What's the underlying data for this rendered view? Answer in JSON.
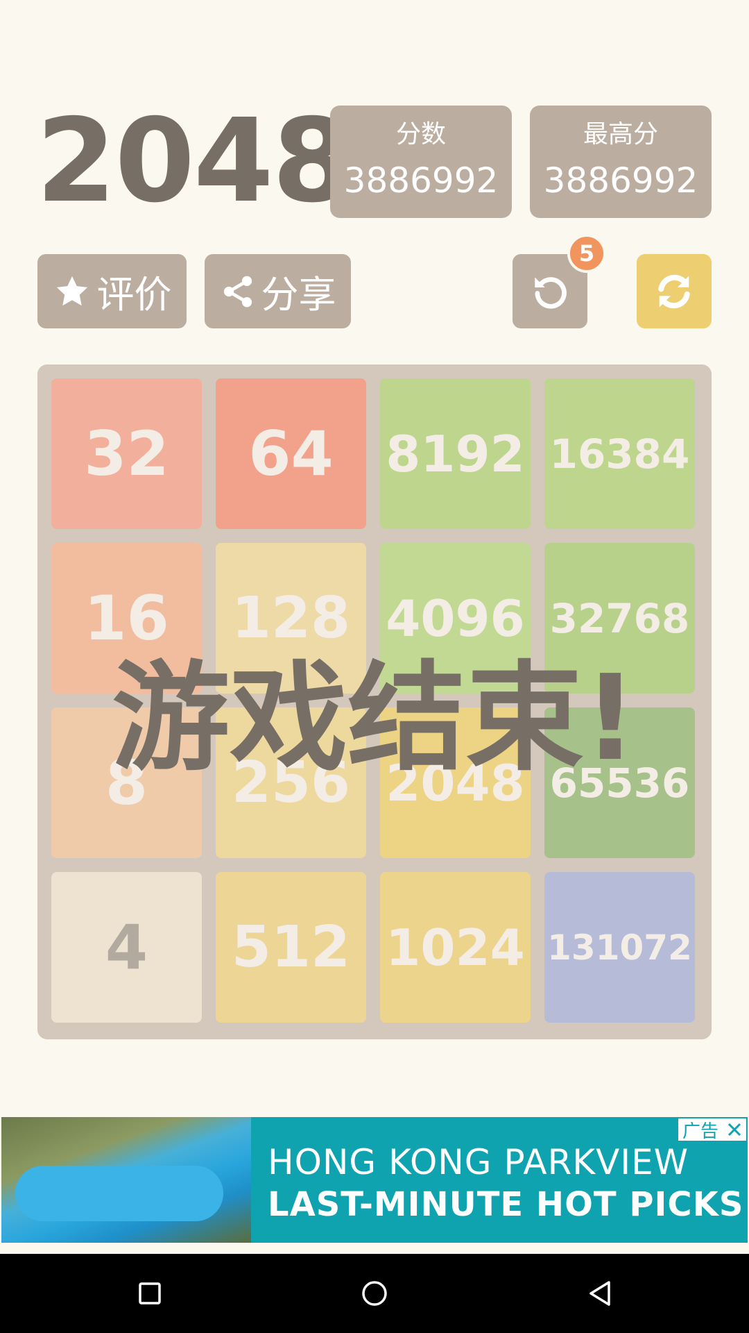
{
  "header": {
    "title": "2048"
  },
  "score": {
    "label": "分数",
    "value": "3886992"
  },
  "best": {
    "label": "最高分",
    "value": "3886992"
  },
  "buttons": {
    "rate": {
      "label": "评价",
      "icon": "star-icon"
    },
    "share": {
      "label": "分享",
      "icon": "share-icon"
    },
    "undo": {
      "icon": "undo-icon",
      "badge": "5"
    },
    "restart": {
      "icon": "refresh-icon"
    }
  },
  "board": {
    "tiles": [
      [
        "32",
        "64",
        "8192",
        "16384"
      ],
      [
        "16",
        "128",
        "4096",
        "32768"
      ],
      [
        "8",
        "256",
        "2048",
        "65536"
      ],
      [
        "4",
        "512",
        "1024",
        "131072"
      ]
    ],
    "colors": {
      "4": "#eee1c9",
      "8": "#f3b27a",
      "16": "#f69664",
      "32": "#f77c5f",
      "64": "#f75f3b",
      "128": "#edd073",
      "256": "#edcc62",
      "512": "#edc950",
      "1024": "#edc53f",
      "2048": "#edc22e",
      "4096": "#97cf4e",
      "8192": "#8dc63f",
      "16384": "#8dc63f",
      "32768": "#82bf3a",
      "65536": "#5f9e38",
      "131072": "#7f95d6"
    },
    "game_over_text": "游戏结束!"
  },
  "ad": {
    "line1": "HONG KONG PARKVIEW",
    "line2": "LAST-MINUTE HOT PICKS",
    "tag": "广告",
    "close_icon": "close-icon"
  },
  "navbar": {
    "icons": [
      "recents-square-icon",
      "home-circle-icon",
      "back-triangle-icon"
    ]
  }
}
